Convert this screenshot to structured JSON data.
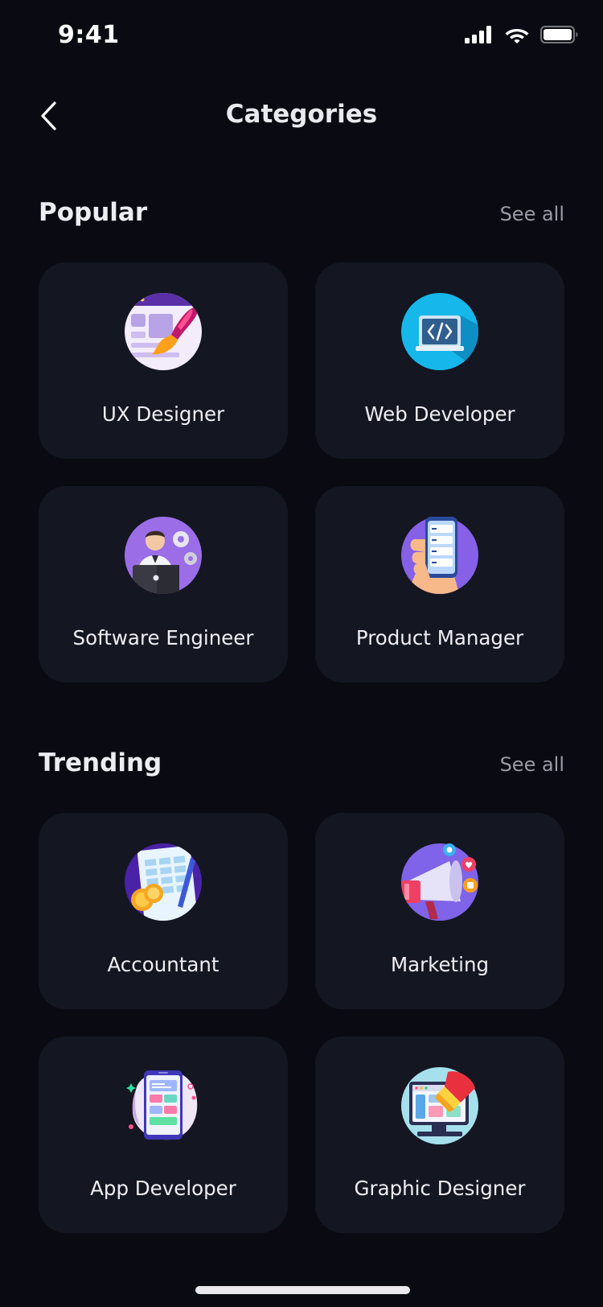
{
  "status": {
    "time": "9:41"
  },
  "header": {
    "title": "Categories"
  },
  "popular": {
    "title": "Popular",
    "see_all": "See all",
    "items": [
      {
        "label": "UX Designer",
        "icon": "ux-designer-icon"
      },
      {
        "label": "Web Developer",
        "icon": "web-developer-icon"
      },
      {
        "label": "Software Engineer",
        "icon": "software-engineer-icon"
      },
      {
        "label": "Product Manager",
        "icon": "product-manager-icon"
      }
    ]
  },
  "trending": {
    "title": "Trending",
    "see_all": "See all",
    "items": [
      {
        "label": "Accountant",
        "icon": "accountant-icon"
      },
      {
        "label": "Marketing",
        "icon": "marketing-icon"
      },
      {
        "label": "App Developer",
        "icon": "app-developer-icon"
      },
      {
        "label": "Graphic Designer",
        "icon": "graphic-designer-icon"
      }
    ]
  },
  "colors": {
    "background": "#0a0b12",
    "card": "#141621",
    "muted": "#9a9aa6"
  }
}
